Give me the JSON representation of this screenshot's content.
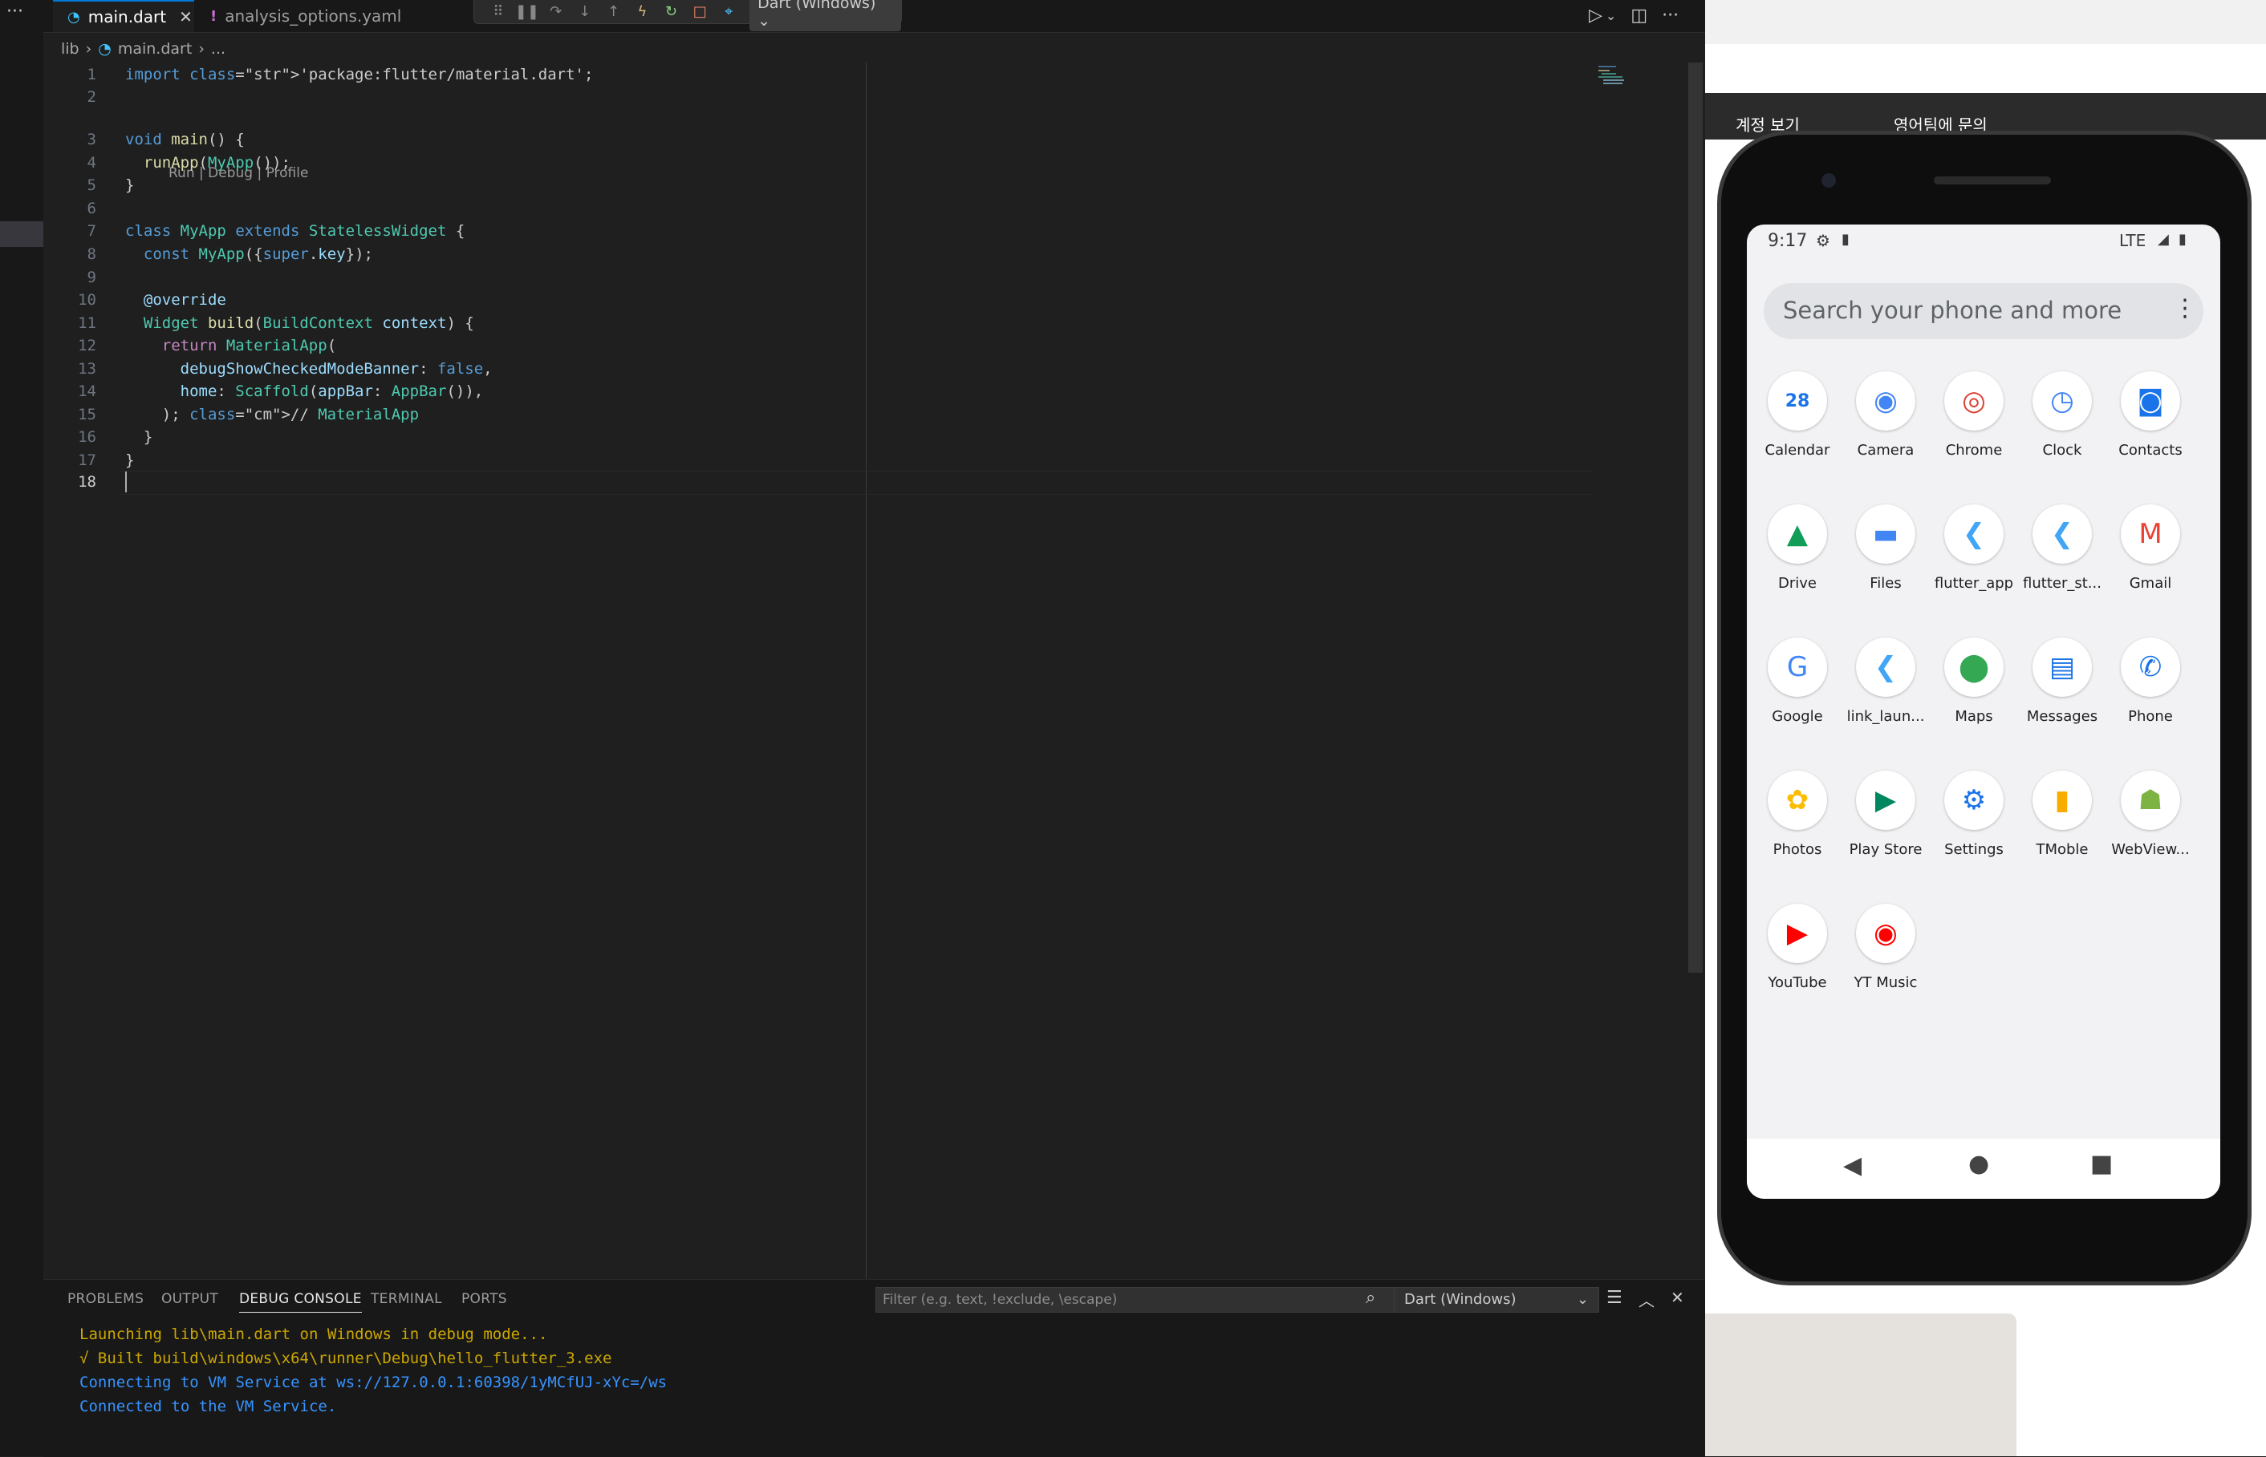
{
  "tabs": [
    {
      "label": "main.dart",
      "icon": "dart-icon",
      "active": true
    },
    {
      "label": "analysis_options.yaml",
      "icon": "warning-icon",
      "active": false
    }
  ],
  "debug_toolbar": {
    "target": "Dart (Windows)"
  },
  "breadcrumb": [
    "lib",
    "main.dart",
    "..."
  ],
  "editor": {
    "codelens": "Run | Debug | Profile",
    "line_numbers": [
      "1",
      "2",
      "3",
      "4",
      "5",
      "6",
      "7",
      "8",
      "9",
      "10",
      "11",
      "12",
      "13",
      "14",
      "15",
      "16",
      "17",
      "18"
    ],
    "current_line": 18,
    "lines": [
      "import 'package:flutter/material.dart';",
      "",
      "void main() {",
      "  runApp(MyApp());",
      "}",
      "",
      "class MyApp extends StatelessWidget {",
      "  const MyApp({super.key});",
      "",
      "  @override",
      "  Widget build(BuildContext context) {",
      "    return MaterialApp(",
      "      debugShowCheckedModeBanner: false,",
      "      home: Scaffold(appBar: AppBar()),",
      "    ); // MaterialApp",
      "  }",
      "}",
      ""
    ]
  },
  "panel": {
    "tabs": [
      "PROBLEMS",
      "OUTPUT",
      "DEBUG CONSOLE",
      "TERMINAL",
      "PORTS"
    ],
    "active_tab": "DEBUG CONSOLE",
    "filter_placeholder": "Filter (e.g. text, !exclude, \\escape)",
    "session": "Dart (Windows)",
    "console": [
      {
        "text": "Launching lib\\main.dart on Windows in debug mode...",
        "color": "#cca700"
      },
      {
        "text": "√ Built build\\windows\\x64\\runner\\Debug\\hello_flutter_3.exe",
        "color": "#cca700"
      },
      {
        "text": "Connecting to VM Service at ws://127.0.0.1:60398/1yMCfUJ-xYc=/ws",
        "color": "#3794ff"
      },
      {
        "text": "Connected to the VM Service.",
        "color": "#3794ff"
      }
    ]
  },
  "background_window": {
    "btn1": "계정 보기",
    "btn2": "영어팀에 문의"
  },
  "phone": {
    "time": "9:17",
    "network": "LTE",
    "search_placeholder": "Search your phone and more",
    "apps": [
      {
        "label": "Calendar",
        "icon": "calendar-icon",
        "glyph": "28",
        "color": "#1a73e8"
      },
      {
        "label": "Camera",
        "icon": "camera-icon",
        "glyph": "◉",
        "color": "#4285f4"
      },
      {
        "label": "Chrome",
        "icon": "chrome-icon",
        "glyph": "◎",
        "color": "#db4437"
      },
      {
        "label": "Clock",
        "icon": "clock-icon",
        "glyph": "◷",
        "color": "#4285f4"
      },
      {
        "label": "Contacts",
        "icon": "contacts-icon",
        "glyph": "◙",
        "color": "#1a73e8"
      },
      {
        "label": "Drive",
        "icon": "drive-icon",
        "glyph": "▲",
        "color": "#0f9d58"
      },
      {
        "label": "Files",
        "icon": "files-icon",
        "glyph": "▬",
        "color": "#4285f4"
      },
      {
        "label": "flutter_app",
        "icon": "flutter-icon",
        "glyph": "❮",
        "color": "#42a5f5"
      },
      {
        "label": "flutter_st...",
        "icon": "flutter-icon",
        "glyph": "❮",
        "color": "#42a5f5"
      },
      {
        "label": "Gmail",
        "icon": "gmail-icon",
        "glyph": "M",
        "color": "#ea4335"
      },
      {
        "label": "Google",
        "icon": "google-icon",
        "glyph": "G",
        "color": "#4285f4"
      },
      {
        "label": "link_laun...",
        "icon": "flutter-icon",
        "glyph": "❮",
        "color": "#42a5f5"
      },
      {
        "label": "Maps",
        "icon": "maps-icon",
        "glyph": "⬤",
        "color": "#34a853"
      },
      {
        "label": "Messages",
        "icon": "messages-icon",
        "glyph": "▤",
        "color": "#1a73e8"
      },
      {
        "label": "Phone",
        "icon": "phone-icon",
        "glyph": "✆",
        "color": "#1a73e8"
      },
      {
        "label": "Photos",
        "icon": "photos-icon",
        "glyph": "✿",
        "color": "#fbbc04"
      },
      {
        "label": "Play Store",
        "icon": "play-store-icon",
        "glyph": "▶",
        "color": "#01875f"
      },
      {
        "label": "Settings",
        "icon": "settings-icon",
        "glyph": "⚙",
        "color": "#1a73e8"
      },
      {
        "label": "TMoble",
        "icon": "tmoble-icon",
        "glyph": "▮",
        "color": "#f9ab00"
      },
      {
        "label": "WebView...",
        "icon": "android-icon",
        "glyph": "☗",
        "color": "#7cb342"
      },
      {
        "label": "YouTube",
        "icon": "youtube-icon",
        "glyph": "▶",
        "color": "#ff0000"
      },
      {
        "label": "YT Music",
        "icon": "yt-music-icon",
        "glyph": "◉",
        "color": "#ff0000"
      }
    ]
  }
}
